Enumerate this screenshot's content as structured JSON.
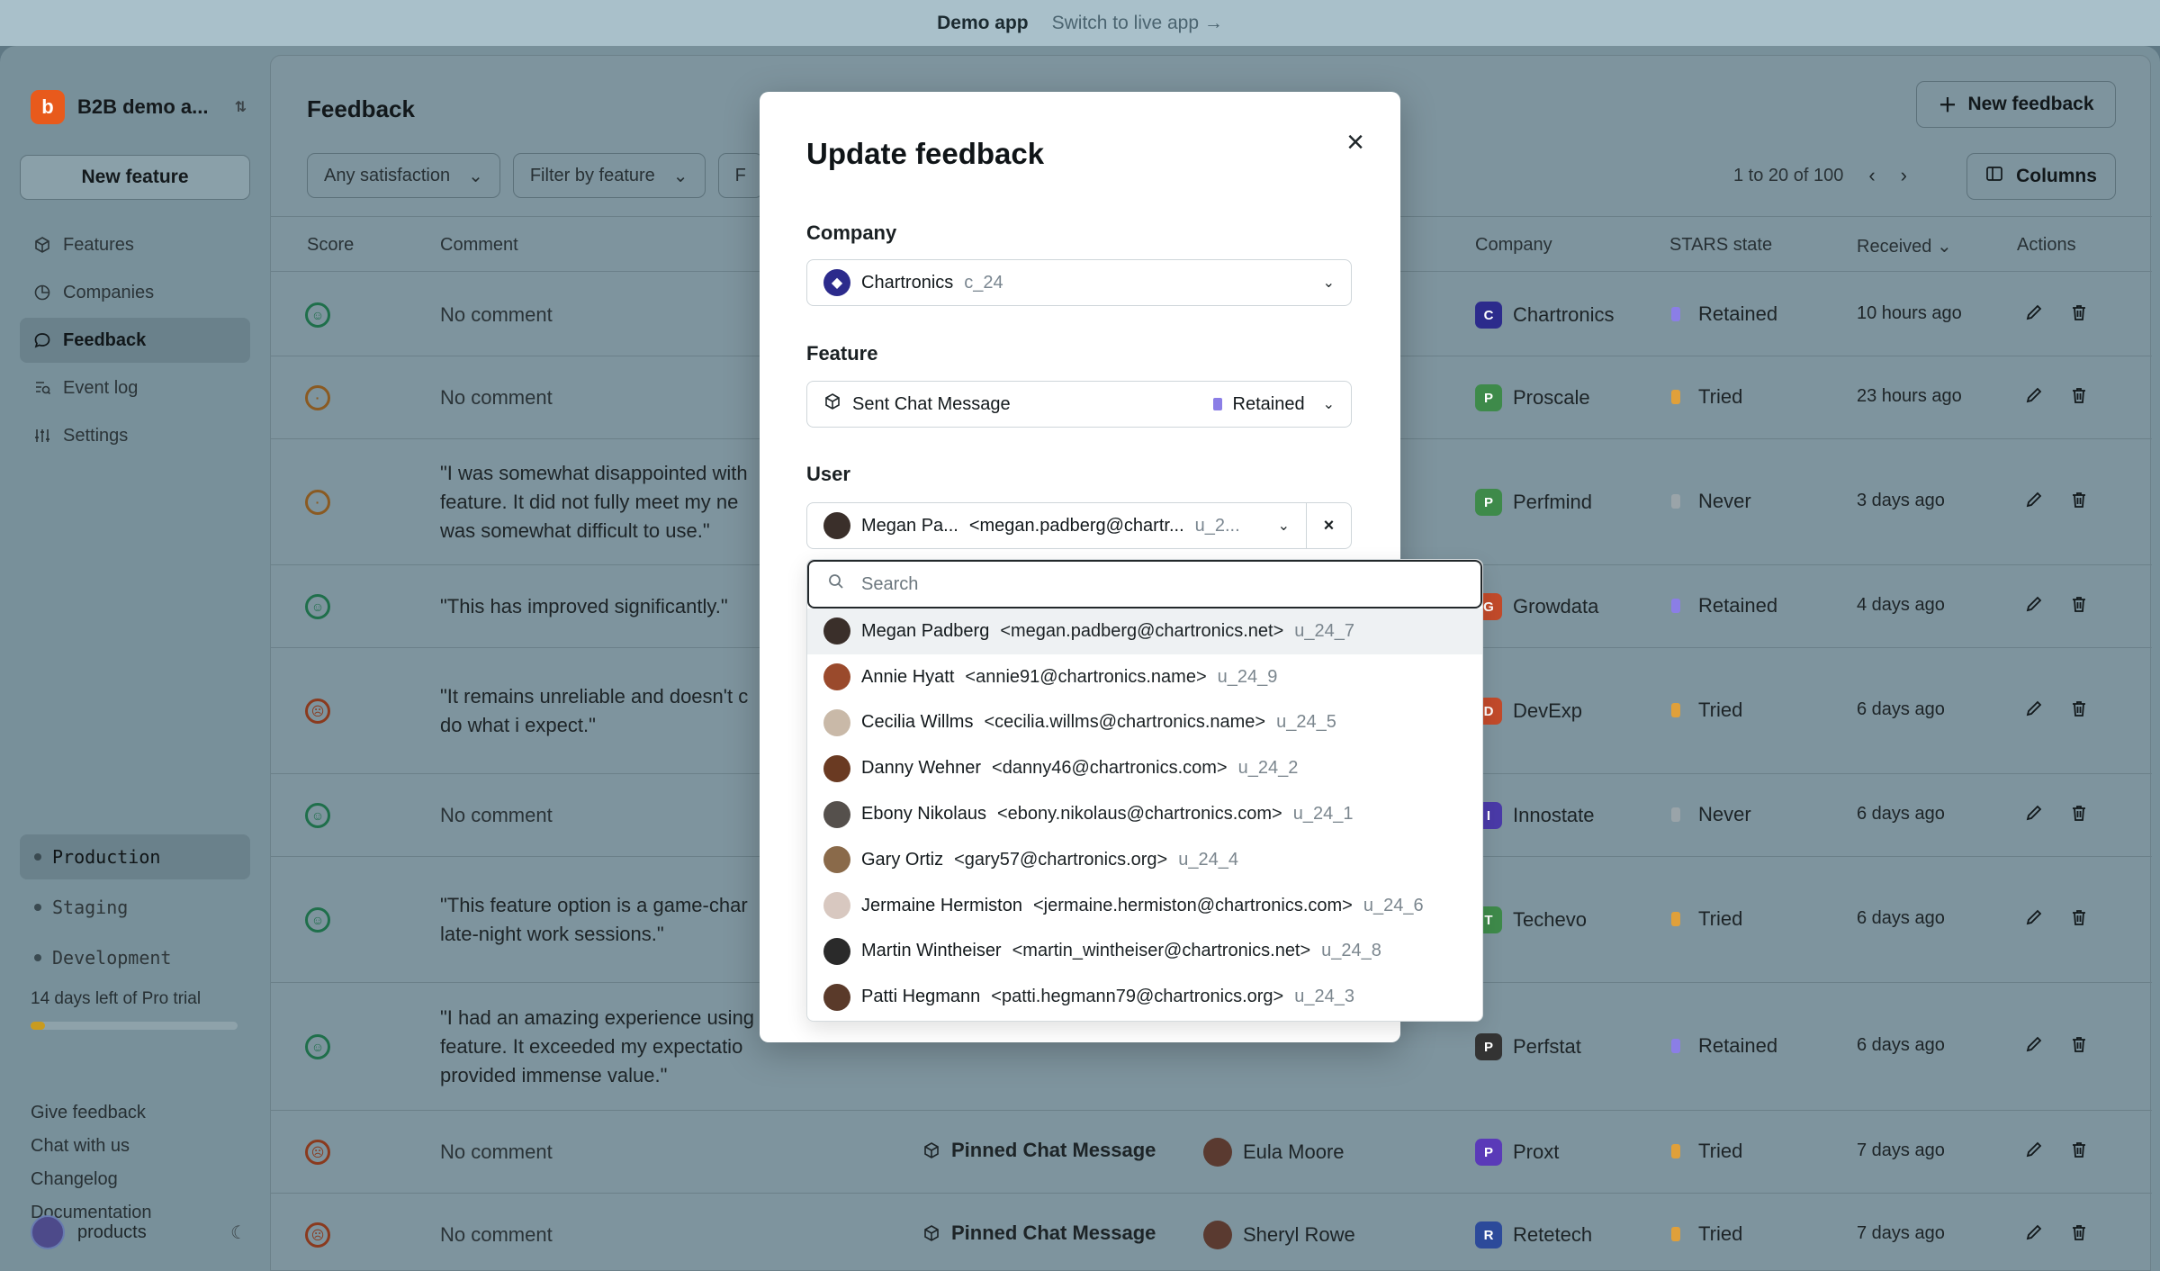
{
  "topbar": {
    "demo": "Demo app",
    "switch": "Switch to live app →"
  },
  "sidebar": {
    "org_name": "B2B demo a...",
    "org_initial": "b",
    "new_feature": "New feature",
    "nav": [
      {
        "label": "Features",
        "icon": "cube-icon"
      },
      {
        "label": "Companies",
        "icon": "pie-icon"
      },
      {
        "label": "Feedback",
        "icon": "chat-icon"
      },
      {
        "label": "Event log",
        "icon": "log-icon"
      },
      {
        "label": "Settings",
        "icon": "sliders-icon"
      }
    ],
    "environments": [
      "Production",
      "Staging",
      "Development"
    ],
    "trial": "14 days left of Pro trial",
    "trial_progress": 0.07,
    "links": [
      "Give feedback",
      "Chat with us",
      "Changelog",
      "Documentation"
    ],
    "account": "products"
  },
  "main": {
    "title": "Feedback",
    "new_feedback": "New feedback",
    "filters": [
      "Any satisfaction",
      "Filter by feature",
      "F"
    ],
    "pager": "1 to 20 of 100",
    "columns": "Columns",
    "headers": {
      "score": "Score",
      "comment": "Comment",
      "company": "Company",
      "stars": "STARS state",
      "received": "Received",
      "actions": "Actions"
    },
    "rows": [
      {
        "score": "good",
        "comment": "No comment",
        "feature": "",
        "user": "",
        "company": "Chartronics",
        "state": "Retained",
        "received": "10 hours ago"
      },
      {
        "score": "ok",
        "comment": "No comment",
        "feature": "",
        "user": "",
        "company": "Proscale",
        "state": "Tried",
        "received": "23 hours ago"
      },
      {
        "score": "ok",
        "comment": "\"I was somewhat disappointed with\nfeature. It did not fully meet my ne\nwas somewhat difficult to use.\"",
        "feature": "",
        "user": "",
        "company": "Perfmind",
        "state": "Never",
        "received": "3 days ago"
      },
      {
        "score": "good",
        "comment": "\"This has improved significantly.\"",
        "feature": "",
        "user": "",
        "company": "Growdata",
        "state": "Retained",
        "received": "4 days ago"
      },
      {
        "score": "bad",
        "comment": "\"It remains unreliable and doesn't c\ndo what i expect.\"",
        "feature": "",
        "user": "",
        "company": "DevExp",
        "state": "Tried",
        "received": "6 days ago"
      },
      {
        "score": "good",
        "comment": "No comment",
        "feature": "",
        "user": "",
        "company": "Innostate",
        "state": "Never",
        "received": "6 days ago"
      },
      {
        "score": "good",
        "comment": "\"This feature option is a game-char\nlate-night work sessions.\"",
        "feature": "",
        "user": "",
        "company": "Techevo",
        "state": "Tried",
        "received": "6 days ago"
      },
      {
        "score": "good",
        "comment": "\"I had an amazing experience using\nfeature. It exceeded my expectatio\nprovided immense value.\"",
        "feature": "",
        "user": "",
        "company": "Perfstat",
        "state": "Retained",
        "received": "6 days ago"
      },
      {
        "score": "bad",
        "comment": "No comment",
        "feature": "Pinned Chat Message",
        "user": "Eula Moore",
        "company": "Proxt",
        "state": "Tried",
        "received": "7 days ago"
      },
      {
        "score": "bad",
        "comment": "No comment",
        "feature": "Pinned Chat Message",
        "user": "Sheryl Rowe",
        "company": "Retetech",
        "state": "Tried",
        "received": "7 days ago"
      }
    ],
    "partial_row_comment": "\"I was somewhat disappointed with this"
  },
  "colors": {
    "retained": "#8b7ee6",
    "tried": "#e0a03a",
    "never": "#9aa4a9"
  },
  "modal": {
    "title": "Update feedback",
    "company_label": "Company",
    "company_value": "Chartronics",
    "company_id": "c_24",
    "feature_label": "Feature",
    "feature_value": "Sent Chat Message",
    "feature_state": "Retained",
    "user_label": "User",
    "user_name": "Megan Pa...",
    "user_email": "<megan.padberg@chartr...",
    "user_id": "u_2...",
    "clear": "×"
  },
  "dropdown": {
    "search_placeholder": "Search",
    "users": [
      {
        "name": "Megan Padberg",
        "email": "<megan.padberg@chartronics.net>",
        "id": "u_24_7",
        "av": "#3a2f2a"
      },
      {
        "name": "Annie Hyatt",
        "email": "<annie91@chartronics.name>",
        "id": "u_24_9",
        "av": "#9a4a2c"
      },
      {
        "name": "Cecilia Willms",
        "email": "<cecilia.willms@chartronics.name>",
        "id": "u_24_5",
        "av": "#c9b9a8"
      },
      {
        "name": "Danny Wehner",
        "email": "<danny46@chartronics.com>",
        "id": "u_24_2",
        "av": "#6a3a22"
      },
      {
        "name": "Ebony Nikolaus",
        "email": "<ebony.nikolaus@chartronics.com>",
        "id": "u_24_1",
        "av": "#55504c"
      },
      {
        "name": "Gary Ortiz",
        "email": "<gary57@chartronics.org>",
        "id": "u_24_4",
        "av": "#8a6a4a"
      },
      {
        "name": "Jermaine Hermiston",
        "email": "<jermaine.hermiston@chartronics.com>",
        "id": "u_24_6",
        "av": "#d8c8c0"
      },
      {
        "name": "Martin Wintheiser",
        "email": "<martin_wintheiser@chartronics.net>",
        "id": "u_24_8",
        "av": "#2a2a2a"
      },
      {
        "name": "Patti Hegmann",
        "email": "<patti.hegmann79@chartronics.org>",
        "id": "u_24_3",
        "av": "#5a3a2a"
      }
    ]
  }
}
